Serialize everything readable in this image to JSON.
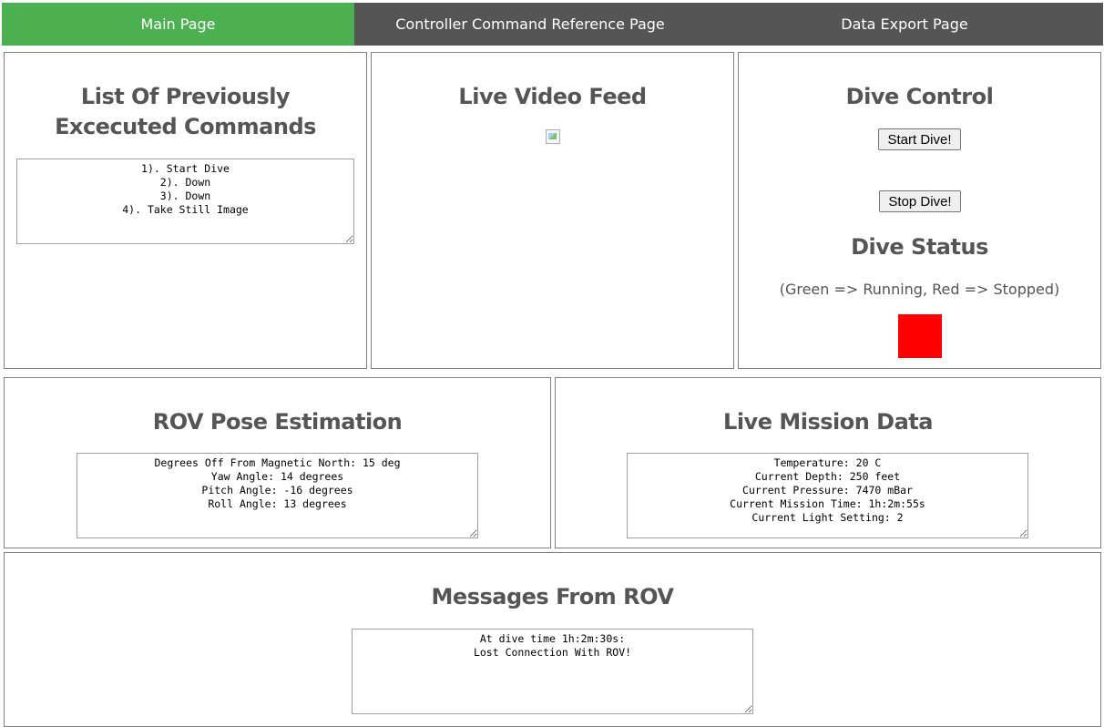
{
  "nav": {
    "tabs": [
      {
        "label": "Main Page",
        "active": true
      },
      {
        "label": "Controller Command Reference Page",
        "active": false
      },
      {
        "label": "Data Export Page",
        "active": false
      }
    ]
  },
  "commands": {
    "title": "List Of Previously Excecuted Commands",
    "list": "1). Start Dive\n2). Down\n3). Down\n4). Take Still Image"
  },
  "video": {
    "title": "Live Video Feed",
    "image_icon": "broken-image-icon"
  },
  "dive_control": {
    "title": "Dive Control",
    "start_label": "Start Dive!",
    "stop_label": "Stop Dive!",
    "status_title": "Dive Status",
    "legend": "(Green => Running, Red => Stopped)",
    "status_color": "#ff0000"
  },
  "pose": {
    "title": "ROV Pose Estimation",
    "text": "Degrees Off From Magnetic North: 15 deg\nYaw Angle: 14 degrees\nPitch Angle: -16 degrees\nRoll Angle: 13 degrees"
  },
  "mission": {
    "title": "Live Mission Data",
    "text": "Temperature: 20 C\nCurrent Depth: 250 feet\nCurrent Pressure: 7470 mBar\nCurrent Mission Time: 1h:2m:55s\nCurrent Light Setting: 2"
  },
  "messages": {
    "title": "Messages From ROV",
    "text": "At dive time 1h:2m:30s:\nLost Connection With ROV!"
  },
  "colors": {
    "nav_bg": "#555555",
    "nav_active": "#4caf50",
    "heading": "#555555"
  }
}
